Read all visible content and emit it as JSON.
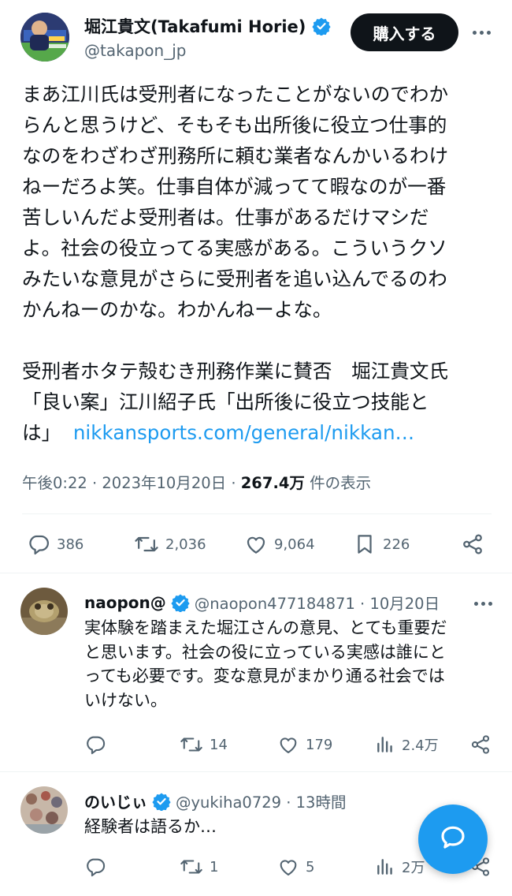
{
  "main_tweet": {
    "author_name": "堀江貴文(Takafumi Horie)",
    "handle": "@takapon_jp",
    "buy_label": "購入する",
    "avatar_icon": "user-avatar-icon",
    "text_lines": [
      "まあ江川氏は受刑者になったことがないのでわか",
      "らんと思うけど、そもそも出所後に役立つ仕事的",
      "なのをわざわざ刑務所に頼む業者なんかいるわけ",
      "ねーだろよ笑。仕事自体が減ってて暇なのが一番",
      "苦しいんだよ受刑者は。仕事があるだけマシだ",
      "よ。社会の役立ってる実感がある。こういうクソ",
      "みたいな意見がさらに受刑者を追い込んでるのわ",
      "かんねーのかな。わかんねーよな。"
    ],
    "quote_lines": [
      "受刑者ホタテ殻むき刑務作業に賛否　堀江貴文氏",
      "「良い案」江川紹子氏「出所後に役立つ技能と"
    ],
    "quote_last_prefix": "は」",
    "link_text": "nikkansports.com/general/nikkan…",
    "timestamp": "午後0:22 · 2023年10月20日 · ",
    "views_count": "267.4万",
    "views_suffix": " 件の表示",
    "replies": "386",
    "retweets": "2,036",
    "likes": "9,064",
    "bookmarks": "226"
  },
  "replies": [
    {
      "name": "naopon@",
      "meta": "@naopon477184871 · 10月20日",
      "text_lines": [
        "実体験を踏まえた堀江さんの意見、とても重要だ",
        "と思います。社会の役に立っている実感は誰にと",
        "っても必要です。変な意見がまかり通る社会では",
        "いけない。"
      ],
      "replies": "",
      "retweets": "14",
      "likes": "179",
      "views": "2.4万"
    },
    {
      "name": "のいじぃ",
      "meta": "@yukiha0729 · 13時間",
      "text_lines": [
        "経験者は語るか…"
      ],
      "replies": "",
      "retweets": "1",
      "likes": "5",
      "views": "2万"
    }
  ],
  "colors": {
    "accent": "#1d9bf0",
    "text": "#0f1419",
    "muted": "#536471",
    "divider": "#eff3f4"
  }
}
